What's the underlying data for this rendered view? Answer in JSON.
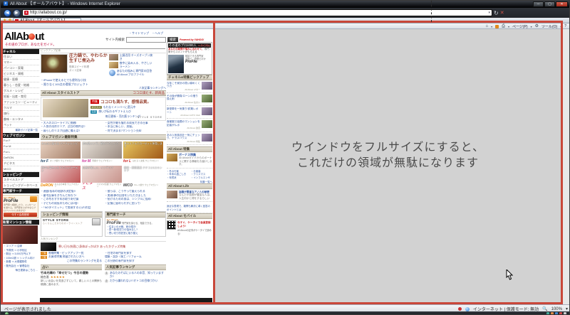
{
  "window": {
    "title": "All About 【オールアバウト】 - Windows Internet Explorer",
    "url": "http://allabout.co.jp/",
    "tab_label": "All About 【オールアバウト】",
    "cmd_page": "ページ(P)",
    "cmd_tools": "ツール(O)",
    "status_done": "ページが表示されました",
    "status_zone": "インターネット | 保護モード: 無効",
    "status_zoom": "100%"
  },
  "annotation": {
    "line1": "ウインドウをフルサイズにすると、",
    "line2": "これだけの領域が無駄になります",
    "red_color": "#c9473a",
    "gray_color": "#d2d2d2"
  },
  "header": {
    "logo_all": "All",
    "logo_ab": "Ab",
    "logo_ut": "ut",
    "tagline": "その道のプロが、あなたをガイド。",
    "top_links": [
      "・サイトマップ",
      "・ヘルプ"
    ],
    "search_label": "サイト内検索",
    "search_button": "検索",
    "powered": "Powered by YAHOO!"
  },
  "sidebar": {
    "channel_header": "チャネル",
    "channels": [
      "住まい",
      "マネー",
      "パソコン・家電",
      "ビジネス・資格",
      "健康・医療",
      "暮らし・恋愛・結婚",
      "グルメ・レシピ",
      "妊娠・出産・育児",
      "ファッション・ビューティ",
      "クルマ",
      "旅行",
      "趣味・エンタメ",
      "ペット"
    ],
    "latest_link": "最新ガイド記事一覧",
    "magazine_header": "ウェブマガジン",
    "magazines": [
      "For F",
      "For M",
      "For L",
      "DeRON",
      "チビタス",
      "MICO"
    ],
    "shopping_header": "ショッピング",
    "shopping_items": [
      "スタイルストア",
      "ショッピングデータベース"
    ],
    "expert_header": "専門家サーチ",
    "profile": {
      "brand_small": "ALL ABOUT",
      "brand": "ProFile",
      "text": "専門家へ相談したり、メッセージを送れる。専門家をさがすならプロファイルにおまかせ!",
      "button": "今すぐ会員登録"
    },
    "mansion_header": "新築マンション情報",
    "mansion_links": [
      "・エリア ⇒ 沿線",
      "・予算別 ⇒ 小学校区",
      "・駅近 ⇒ 3,000万円以下",
      "・100m2超 ⇒ シングル向け",
      "・新着 ⇒ 大規模物件",
      "・販売会社 ⇒ 管理会社"
    ],
    "mansion_more": "毎日更新はこちら…"
  },
  "main": {
    "pickup_label": "ピックアップ記事",
    "feature": {
      "title1": "圧力鍋で、やわらか",
      "title2": "生すじ煮込み",
      "meta1": "簡単スピード料理",
      "meta2": "ガイド記事"
    },
    "side_items": [
      {
        "text": "土鍋活用 チーズオーブン焼き"
      },
      {
        "text": "夜中に染み入る、やさしいラーメン"
      },
      {
        "text": "あなたの悩みに専門家の回答 All About プロファイル"
      }
    ],
    "quick_links": [
      "・iPhoneで使えるとても便利な小技",
      "・限りなく100点の環境プロジェクト"
    ],
    "ranking_link": "人気記事ランキングへ",
    "store": {
      "bar_left": "All About スタイルストア",
      "bar_right": "ココロ満たす、新商品",
      "tag": "特集",
      "headline": "ココロも満たす、感情品質。",
      "rows": [
        {
          "tag": "オススメ",
          "text": "もれなくメンバーに還元中"
        },
        {
          "tag": "注目",
          "text": "想いが伝わるギフトえらび"
        },
        {
          "tag": "ランキング",
          "text": "毎日更新・売れ筋ランキング"
        }
      ],
      "logo": "STYLE STORE"
    },
    "links_a": [
      "・大人のスローライフに挑戦!",
      "・人気の湾岸エリア、注目の物件は?",
      "・暮らしのリスク回避に備えは?"
    ],
    "links_b": [
      "・女性が最も憧れる成長できる仕事",
      "・本当に新しい、男服。",
      "・何で決まる?マンション売却"
    ],
    "magazine_bar": "ウェブマガジン最新特集",
    "tiles": [
      {
        "caption": "みんなと話せる パーティレシピ",
        "brand": "for F",
        "tagline": "オンナ磨き ウェブマガジン"
      },
      {
        "caption": "男の肌メンテ、朝のテクニック",
        "brand": "for M",
        "tagline": "男磨き ウェブマガジン"
      },
      {
        "caption": "妻のリアルクローゼット拝見します",
        "brand": "for L",
        "tagline": "はたらく女性 ウェブマガジン"
      },
      {
        "caption": "夜中に染み入る やさしいラーメン",
        "brand": "DeRON",
        "tagline": "おんなの本音 ウェブマガジン"
      },
      {
        "caption": "成長が楽しい、インテリア",
        "brand": "チビタス",
        "tagline": "パパママ応援 ウェブマガジン"
      },
      {
        "caption": "艶髪・艶肌復活 クチコミ&スキンケア",
        "brand": "MICO",
        "tagline": "キレイ磨き ウェブマガジン"
      }
    ],
    "links_c": [
      "・連載!長寿の秘訣の決定版!!",
      "・慶弔記事をきちんと知ろう!",
      "・この冬おすすめお取り寄せ鍋",
      "・子どもの成長のためには2倍!",
      "・「NOダイエット」で実現する1万円の話"
    ],
    "links_d": [
      "・彼らは、こうやって鍛えられる",
      "・実現!夢の回答をいただきました",
      "・続けるための男は、シンプルに悩め!",
      "・記憶に留められずに困って!"
    ],
    "shopinfo_bar": "ショッピング情報",
    "shopinfo_logo": "STYLE STORE",
    "shopinfo_sub": "らくちんこだわりのオンラインストア",
    "expertsearch_bar": "専門家サーチ",
    "expertsearch_brand_small": "ALL ABOUT",
    "expertsearch_brand": "ProFile",
    "expertsearch_tagline": "専門家を探せる、相談できる。",
    "expertsearch_links": [
      "・住まいの大敵、家の傾き!",
      "・窓一新!防犯での悩みなし?",
      "・思い切り防犯窓に取り替え"
    ],
    "hot_label": "人気ランキング",
    "hot_item": "寒い日も快適に!身体ぽっかぽか あったかグッズ特集",
    "feature_links": [
      {
        "tag": "一覧",
        "text": "各種特集・ピックアップ一覧"
      },
      {
        "tag": "一覧",
        "text": "お買得特集 掲載されたい方へ"
      }
    ],
    "feature_more": "この特集のランキングを見る",
    "expert_links": [
      "・住宅の専門家を探す",
      "増築・設計 / 施工 / リフォーム",
      "この分野の専門家を探す"
    ],
    "uranai_bar": "占い",
    "uranai_title": "竹本光晴の「幸せだつ」今日の運勢",
    "uranai_sub": "総合運:",
    "uranai_stars": "★★★★★",
    "uranai_text": "新しい出会いを見逃さずにいて。親しい人との関係も順調に進みます。",
    "ranking_bar": "人気記事ランキング",
    "ranking_items": [
      {
        "n": "1",
        "text": "あなたのそばにいる人の本音、知っていますか?"
      },
      {
        "n": "2",
        "text": "だから嫌われない!?オトコの目線づかい"
      }
    ]
  },
  "right": {
    "pro_header": "その道のプロ1000人",
    "pro_date": "12月5日現在",
    "pro_text1": "あなたの疑問や悩みに合わせて、",
    "pro_text2": "専門家からコメントがもらえる",
    "pro_side1": "相談できる専門家",
    "pro_side2": "弁護士・税理士ほか",
    "pro_brand": "ProFile",
    "pickup_bar": "チャネル&特集ピックアップ",
    "pickups": [
      {
        "text": "今年こそ家計の賢い締めくくり方",
        "src": "All About マネー"
      },
      {
        "text": "その後が勝負!ローンの借り換え術",
        "src": "All About 住まい"
      },
      {
        "text": "新型車を一気乗り!試乗レポート",
        "src": "All About AUTO Club"
      },
      {
        "text": "首都圏で話題のマンションを記者がルポ",
        "src": "All About 賃貸"
      },
      {
        "text": "あの人気商品を一気にチェック、テラスハウス",
        "src": "All About 特集"
      }
    ],
    "tokushu_bar": "All About 特集",
    "tokushu_title": "ボーナス特集",
    "tokushu_text": "All Aboutガイドからのボーナスに関する情報をお届けします。",
    "tokushu_links_a": [
      "・冬の行楽",
      "・年末の過ごし方",
      "・年賀状"
    ],
    "tokushu_links_b": [
      "・お歳暮",
      "・クリスマス",
      "・インフルエンザ"
    ],
    "tokushu_more": "特集一覧へ",
    "life_bar": "All About Life",
    "life_title": "話題が豊富なアノ人の秘密",
    "life_text": "なんだか話題が豊富な人は、人生何かと得をするらしい",
    "life2_text": "身近な表現で、難問も解決に導く回答のポイントとは",
    "mobile_bar": "All About モバイル",
    "mobile_title": "今すぐ、ケータイで会員登録しよう!",
    "mobile_text": "All Aboutの記事がケータイで読める!"
  }
}
